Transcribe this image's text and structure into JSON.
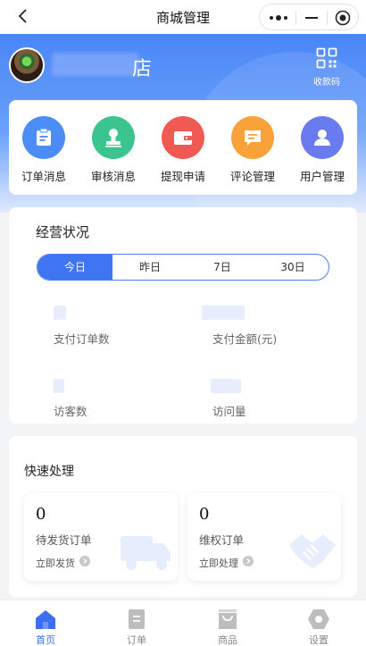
{
  "navbar": {
    "title": "商城管理"
  },
  "header": {
    "shop_name": "店",
    "qr_label": "收款码"
  },
  "quick_menu": [
    {
      "label": "订单消息",
      "icon": "clipboard-icon",
      "color": "#4b8cf6"
    },
    {
      "label": "审核消息",
      "icon": "stamp-icon",
      "color": "#3cc48f"
    },
    {
      "label": "提现申请",
      "icon": "wallet-icon",
      "color": "#f05a52"
    },
    {
      "label": "评论管理",
      "icon": "comment-icon",
      "color": "#f9a23a"
    },
    {
      "label": "用户管理",
      "icon": "user-icon",
      "color": "#6a7bf0"
    }
  ],
  "business": {
    "title": "经营状况",
    "periods": [
      "今日",
      "昨日",
      "7日",
      "30日"
    ],
    "active_period": "今日",
    "stats": [
      {
        "label": "支付订单数"
      },
      {
        "label": "支付金额(元)"
      },
      {
        "label": "访客数"
      },
      {
        "label": "访问量"
      }
    ]
  },
  "fast": {
    "title": "快速处理",
    "cards": [
      {
        "count": "0",
        "name": "待发货订单",
        "action": "立即发货"
      },
      {
        "count": "0",
        "name": "维权订单",
        "action": "立即处理"
      }
    ]
  },
  "tabbar": [
    {
      "label": "首页",
      "icon": "home-icon",
      "active": true
    },
    {
      "label": "订单",
      "icon": "order-icon",
      "active": false
    },
    {
      "label": "商品",
      "icon": "bag-icon",
      "active": false
    },
    {
      "label": "设置",
      "icon": "settings-icon",
      "active": false
    }
  ],
  "colors": {
    "primary": "#3f74f2",
    "header_top": "#4a86f7"
  }
}
